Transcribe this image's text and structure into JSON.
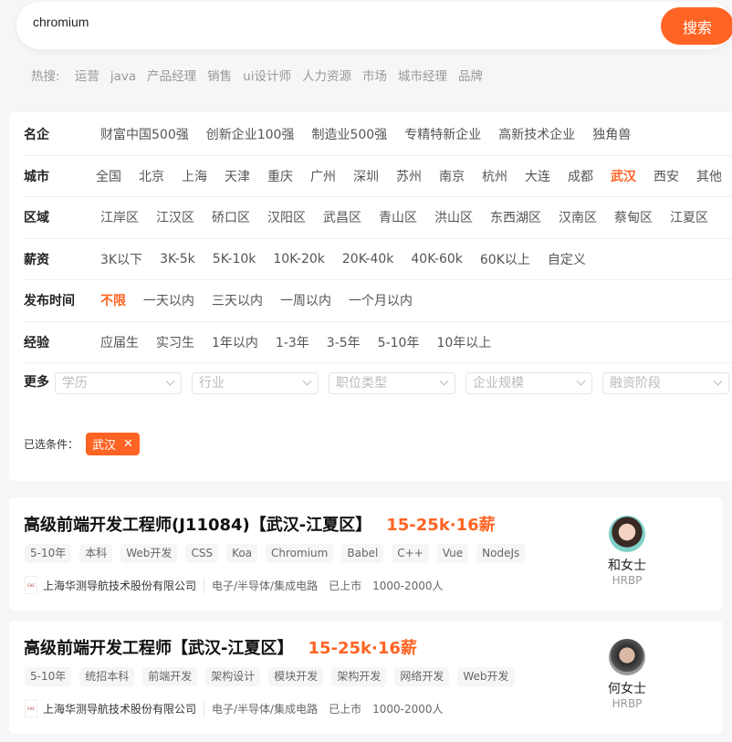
{
  "search": {
    "value": "chromium",
    "button": "搜索"
  },
  "hot": {
    "label": "热搜:",
    "items": [
      "运营",
      "java",
      "产品经理",
      "销售",
      "ui设计师",
      "人力资源",
      "市场",
      "城市经理",
      "品牌"
    ]
  },
  "filters": [
    {
      "label": "名企",
      "options": [
        "财富中国500强",
        "创新企业100强",
        "制造业500强",
        "专精特新企业",
        "高新技术企业",
        "独角兽"
      ],
      "active": -1
    },
    {
      "label": "城市",
      "options": [
        "全国",
        "北京",
        "上海",
        "天津",
        "重庆",
        "广州",
        "深圳",
        "苏州",
        "南京",
        "杭州",
        "大连",
        "成都",
        "武汉",
        "西安",
        "其他"
      ],
      "active": 12
    },
    {
      "label": "区域",
      "options": [
        "江岸区",
        "江汉区",
        "硚口区",
        "汉阳区",
        "武昌区",
        "青山区",
        "洪山区",
        "东西湖区",
        "汉南区",
        "蔡甸区",
        "江夏区"
      ],
      "active": -1
    },
    {
      "label": "薪资",
      "options": [
        "3K以下",
        "3K-5k",
        "5K-10k",
        "10K-20k",
        "20K-40k",
        "40K-60k",
        "60K以上",
        "自定义"
      ],
      "active": -1
    },
    {
      "label": "发布时间",
      "options": [
        "不限",
        "一天以内",
        "三天以内",
        "一周以内",
        "一个月以内"
      ],
      "active": 0
    },
    {
      "label": "经验",
      "options": [
        "应届生",
        "实习生",
        "1年以内",
        "1-3年",
        "3-5年",
        "5-10年",
        "10年以上"
      ],
      "active": -1
    }
  ],
  "more": {
    "label": "更多",
    "selects": [
      "学历",
      "行业",
      "职位类型",
      "企业规模",
      "融资阶段"
    ]
  },
  "chosen": {
    "label": "已选条件：",
    "chips": [
      "武汉"
    ]
  },
  "accent": "#ff6424",
  "jobs": [
    {
      "title": "高级前端开发工程师(J11084)【武汉-江夏区】",
      "salary": "15-25k·16薪",
      "tags": [
        "5-10年",
        "本科",
        "Web开发",
        "CSS",
        "Koa",
        "Chromium",
        "Babel",
        "C++",
        "Vue",
        "NodeJs"
      ],
      "company": "上海华测导航技术股份有限公司",
      "industry": "电子/半导体/集成电路",
      "stage": "已上市",
      "size": "1000-2000人",
      "hr_name": "和女士",
      "hr_title": "HRBP"
    },
    {
      "title": "高级前端开发工程师【武汉-江夏区】",
      "salary": "15-25k·16薪",
      "tags": [
        "5-10年",
        "统招本科",
        "前端开发",
        "架构设计",
        "模块开发",
        "架构开发",
        "网络开发",
        "Web开发"
      ],
      "company": "上海华测导航技术股份有限公司",
      "industry": "电子/半导体/集成电路",
      "stage": "已上市",
      "size": "1000-2000人",
      "hr_name": "何女士",
      "hr_title": "HRBP"
    }
  ]
}
